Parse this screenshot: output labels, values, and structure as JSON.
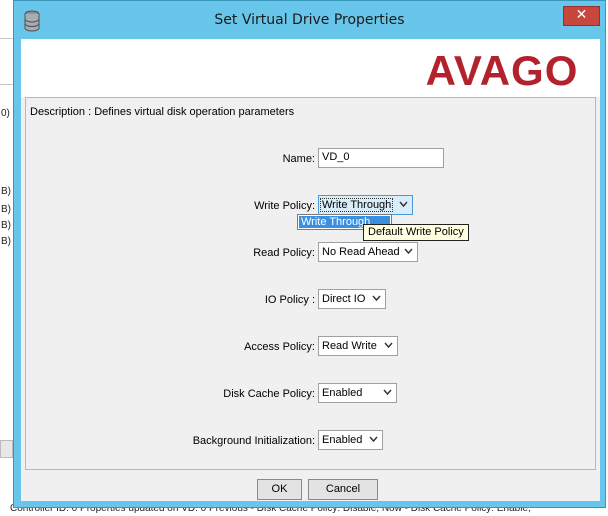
{
  "background": {
    "left_labels": [
      "0)",
      "B)",
      "B)",
      "B)",
      "B)"
    ],
    "status_text": "Controller ID: 0 Properties updated on VD: 0 Previous - Disk Cache Policy: Disable; Now - Disk Cache Policy: Enable;"
  },
  "dialog": {
    "title": "Set Virtual Drive Properties",
    "close_glyph": "✕",
    "logo_text": "AVAGO",
    "description": "Description : Defines virtual disk operation parameters",
    "fields": {
      "name": {
        "label": "Name:",
        "value": "VD_0"
      },
      "write_policy": {
        "label": "Write Policy:",
        "value": "Write Through"
      },
      "read_policy": {
        "label": "Read Policy:",
        "value": "No Read Ahead"
      },
      "io_policy": {
        "label": "IO Policy :",
        "value": "Direct IO"
      },
      "access_policy": {
        "label": "Access Policy:",
        "value": "Read Write"
      },
      "disk_cache_policy": {
        "label": "Disk Cache Policy:",
        "value": "Enabled"
      },
      "background_init": {
        "label": "Background Initialization:",
        "value": "Enabled"
      }
    },
    "dropdown_open": {
      "items": [
        "Write Through"
      ]
    },
    "tooltip": "Default Write Policy",
    "buttons": {
      "ok": "OK",
      "cancel": "Cancel"
    }
  },
  "colors": {
    "titlebar": "#68c6ea",
    "close_button": "#c7463d",
    "logo_red": "#b2222c",
    "selection": "#3b8fe0",
    "tooltip_bg": "#ffffe1"
  },
  "icons": {
    "title_icon": "database-icon",
    "combo_arrow": "chevron-down-icon"
  }
}
